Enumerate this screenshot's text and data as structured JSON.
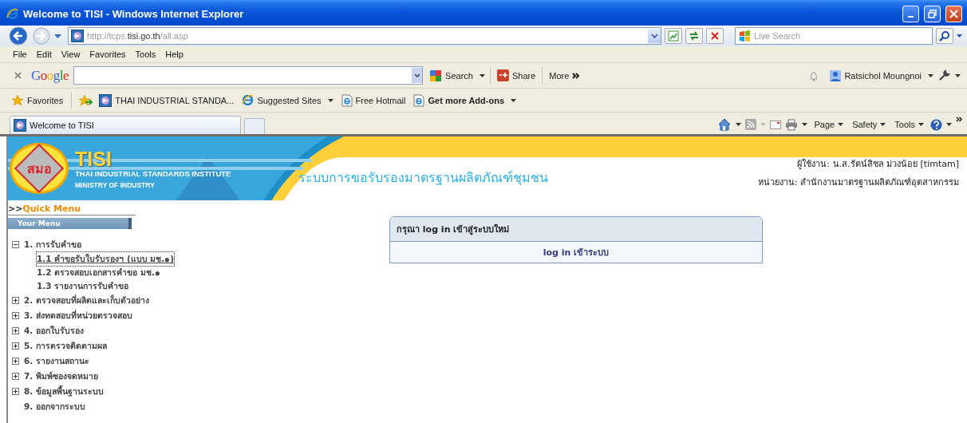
{
  "window": {
    "title": "Welcome to TISI - Windows Internet Explorer"
  },
  "address_bar": {
    "url": "http://tcps.**tisi.go.th**/all.asp",
    "search_placeholder": "Live Search"
  },
  "menu_bar": [
    "File",
    "Edit",
    "View",
    "Favorites",
    "Tools",
    "Help"
  ],
  "google_toolbar": {
    "logo": "Google",
    "search_label": "Search",
    "share_label": "Share",
    "more_label": "More",
    "user_name": "Ratsichol Moungnoi"
  },
  "favorites_bar": {
    "label": "Favorites",
    "items": [
      {
        "label": "THAI INDUSTRIAL STANDA...",
        "kind": "site",
        "dropdown": false,
        "emphasized": false
      },
      {
        "label": "Suggested Sites",
        "kind": "ie",
        "dropdown": true,
        "emphasized": false
      },
      {
        "label": "Free Hotmail",
        "kind": "page",
        "dropdown": false,
        "emphasized": false
      },
      {
        "label": "Get more Add-ons",
        "kind": "page",
        "dropdown": true,
        "emphasized": true
      }
    ]
  },
  "tabs": [
    {
      "label": "Welcome to TISI",
      "selected": true
    }
  ],
  "command_bar": [
    "Page",
    "Safety",
    "Tools"
  ],
  "banner": {
    "logo_text": "สมอ",
    "acronym": "TISI",
    "name": "THAI INDUSTRIAL STANDARDS INSTITUTE",
    "ministry": "MINISTRY OF INDUSTRY",
    "system_title": "ระบบการขอรับรองมาตรฐานผลิตภัณฑ์ชุมชน",
    "user_line": "ผู้ใช้งาน: น.ส.รัตน์สิชล ม่วงน้อย [timtam]",
    "unit_line": "หน่วยงาน: สำนักงานมาตรฐานผลิตภัณฑ์อุตสาหกรรม"
  },
  "sidebar": {
    "quick_menu": ">>**Quick Menu**",
    "your_menu": "Your Menu",
    "items": [
      {
        "label": "1. การรับคำขอ",
        "kind": "folder",
        "expanded": true,
        "children": [
          {
            "label": "1.1 คำขอรับใบรับรองฯ (แบบ มช.๑)",
            "selected": true
          },
          {
            "label": "1.2 ตรวจสอบเอกสารคำขอ มช.๑",
            "selected": false
          },
          {
            "label": "1.3 รายงานการรับคำขอ",
            "selected": false
          }
        ]
      },
      {
        "label": "2. ตรวจสอบที่ผลิตและเก็บตัวอย่าง",
        "kind": "folder",
        "expanded": false
      },
      {
        "label": "3. ส่งทดสอบที่หน่วยตรวจสอบ",
        "kind": "folder",
        "expanded": false
      },
      {
        "label": "4. ออกใบรับรอง",
        "kind": "folder",
        "expanded": false
      },
      {
        "label": "5. การตรวจติดตามผล",
        "kind": "folder",
        "expanded": false
      },
      {
        "label": "6. รายงานสถานะ",
        "kind": "folder",
        "expanded": false
      },
      {
        "label": "7. พิมพ์ซองจดหมาย",
        "kind": "folder",
        "expanded": false
      },
      {
        "label": "8. ข้อมูลพื้นฐานระบบ",
        "kind": "folder",
        "expanded": false
      },
      {
        "label": "9. ออกจากระบบ",
        "kind": "leaf"
      }
    ]
  },
  "login_panel": {
    "header": "กรุณา log in เข้าสู่ระบบใหม่",
    "link": "log in เข้าระบบ"
  }
}
